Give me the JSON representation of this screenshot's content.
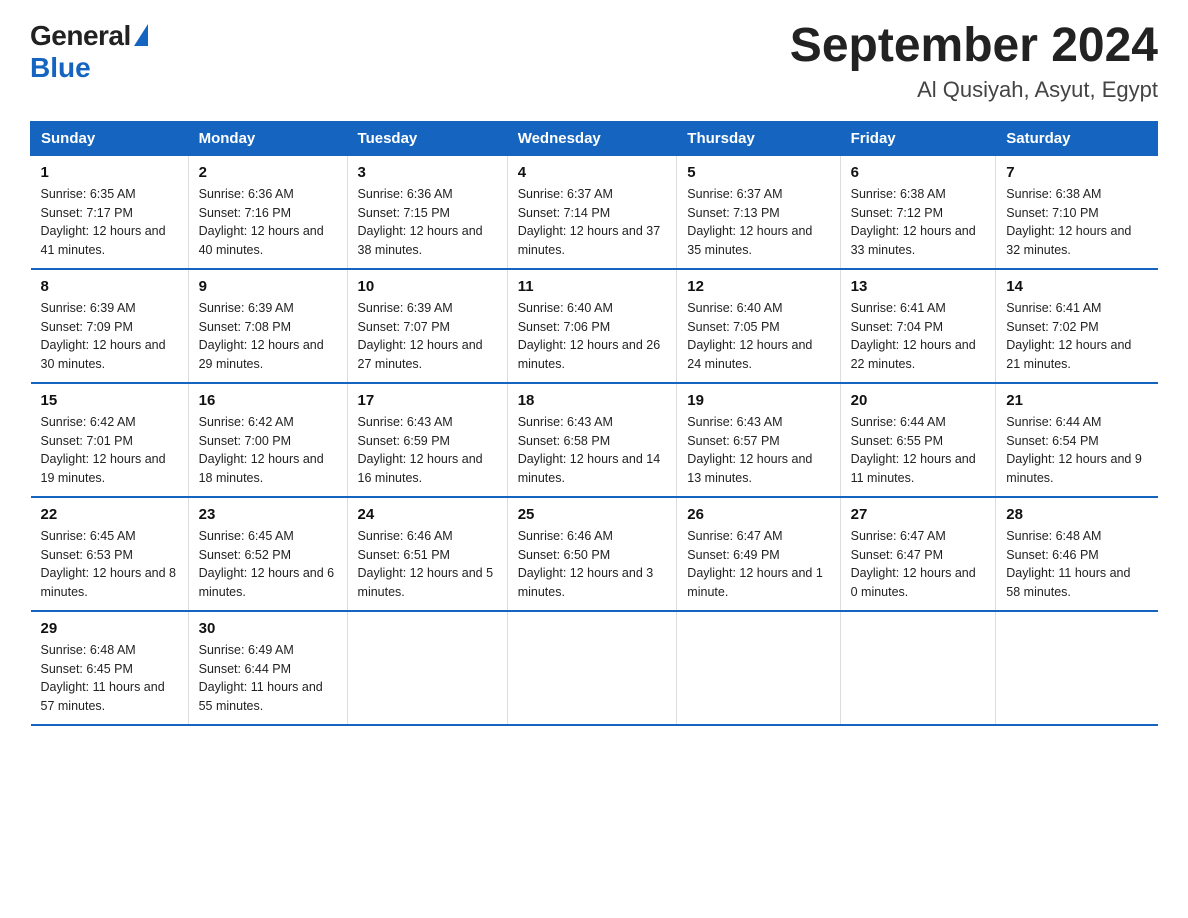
{
  "logo": {
    "general": "General",
    "blue": "Blue"
  },
  "title": "September 2024",
  "location": "Al Qusiyah, Asyut, Egypt",
  "days_header": [
    "Sunday",
    "Monday",
    "Tuesday",
    "Wednesday",
    "Thursday",
    "Friday",
    "Saturday"
  ],
  "weeks": [
    [
      {
        "num": "1",
        "sunrise": "6:35 AM",
        "sunset": "7:17 PM",
        "daylight": "12 hours and 41 minutes."
      },
      {
        "num": "2",
        "sunrise": "6:36 AM",
        "sunset": "7:16 PM",
        "daylight": "12 hours and 40 minutes."
      },
      {
        "num": "3",
        "sunrise": "6:36 AM",
        "sunset": "7:15 PM",
        "daylight": "12 hours and 38 minutes."
      },
      {
        "num": "4",
        "sunrise": "6:37 AM",
        "sunset": "7:14 PM",
        "daylight": "12 hours and 37 minutes."
      },
      {
        "num": "5",
        "sunrise": "6:37 AM",
        "sunset": "7:13 PM",
        "daylight": "12 hours and 35 minutes."
      },
      {
        "num": "6",
        "sunrise": "6:38 AM",
        "sunset": "7:12 PM",
        "daylight": "12 hours and 33 minutes."
      },
      {
        "num": "7",
        "sunrise": "6:38 AM",
        "sunset": "7:10 PM",
        "daylight": "12 hours and 32 minutes."
      }
    ],
    [
      {
        "num": "8",
        "sunrise": "6:39 AM",
        "sunset": "7:09 PM",
        "daylight": "12 hours and 30 minutes."
      },
      {
        "num": "9",
        "sunrise": "6:39 AM",
        "sunset": "7:08 PM",
        "daylight": "12 hours and 29 minutes."
      },
      {
        "num": "10",
        "sunrise": "6:39 AM",
        "sunset": "7:07 PM",
        "daylight": "12 hours and 27 minutes."
      },
      {
        "num": "11",
        "sunrise": "6:40 AM",
        "sunset": "7:06 PM",
        "daylight": "12 hours and 26 minutes."
      },
      {
        "num": "12",
        "sunrise": "6:40 AM",
        "sunset": "7:05 PM",
        "daylight": "12 hours and 24 minutes."
      },
      {
        "num": "13",
        "sunrise": "6:41 AM",
        "sunset": "7:04 PM",
        "daylight": "12 hours and 22 minutes."
      },
      {
        "num": "14",
        "sunrise": "6:41 AM",
        "sunset": "7:02 PM",
        "daylight": "12 hours and 21 minutes."
      }
    ],
    [
      {
        "num": "15",
        "sunrise": "6:42 AM",
        "sunset": "7:01 PM",
        "daylight": "12 hours and 19 minutes."
      },
      {
        "num": "16",
        "sunrise": "6:42 AM",
        "sunset": "7:00 PM",
        "daylight": "12 hours and 18 minutes."
      },
      {
        "num": "17",
        "sunrise": "6:43 AM",
        "sunset": "6:59 PM",
        "daylight": "12 hours and 16 minutes."
      },
      {
        "num": "18",
        "sunrise": "6:43 AM",
        "sunset": "6:58 PM",
        "daylight": "12 hours and 14 minutes."
      },
      {
        "num": "19",
        "sunrise": "6:43 AM",
        "sunset": "6:57 PM",
        "daylight": "12 hours and 13 minutes."
      },
      {
        "num": "20",
        "sunrise": "6:44 AM",
        "sunset": "6:55 PM",
        "daylight": "12 hours and 11 minutes."
      },
      {
        "num": "21",
        "sunrise": "6:44 AM",
        "sunset": "6:54 PM",
        "daylight": "12 hours and 9 minutes."
      }
    ],
    [
      {
        "num": "22",
        "sunrise": "6:45 AM",
        "sunset": "6:53 PM",
        "daylight": "12 hours and 8 minutes."
      },
      {
        "num": "23",
        "sunrise": "6:45 AM",
        "sunset": "6:52 PM",
        "daylight": "12 hours and 6 minutes."
      },
      {
        "num": "24",
        "sunrise": "6:46 AM",
        "sunset": "6:51 PM",
        "daylight": "12 hours and 5 minutes."
      },
      {
        "num": "25",
        "sunrise": "6:46 AM",
        "sunset": "6:50 PM",
        "daylight": "12 hours and 3 minutes."
      },
      {
        "num": "26",
        "sunrise": "6:47 AM",
        "sunset": "6:49 PM",
        "daylight": "12 hours and 1 minute."
      },
      {
        "num": "27",
        "sunrise": "6:47 AM",
        "sunset": "6:47 PM",
        "daylight": "12 hours and 0 minutes."
      },
      {
        "num": "28",
        "sunrise": "6:48 AM",
        "sunset": "6:46 PM",
        "daylight": "11 hours and 58 minutes."
      }
    ],
    [
      {
        "num": "29",
        "sunrise": "6:48 AM",
        "sunset": "6:45 PM",
        "daylight": "11 hours and 57 minutes."
      },
      {
        "num": "30",
        "sunrise": "6:49 AM",
        "sunset": "6:44 PM",
        "daylight": "11 hours and 55 minutes."
      },
      {
        "num": "",
        "sunrise": "",
        "sunset": "",
        "daylight": ""
      },
      {
        "num": "",
        "sunrise": "",
        "sunset": "",
        "daylight": ""
      },
      {
        "num": "",
        "sunrise": "",
        "sunset": "",
        "daylight": ""
      },
      {
        "num": "",
        "sunrise": "",
        "sunset": "",
        "daylight": ""
      },
      {
        "num": "",
        "sunrise": "",
        "sunset": "",
        "daylight": ""
      }
    ]
  ],
  "labels": {
    "sunrise": "Sunrise:",
    "sunset": "Sunset:",
    "daylight": "Daylight:"
  }
}
